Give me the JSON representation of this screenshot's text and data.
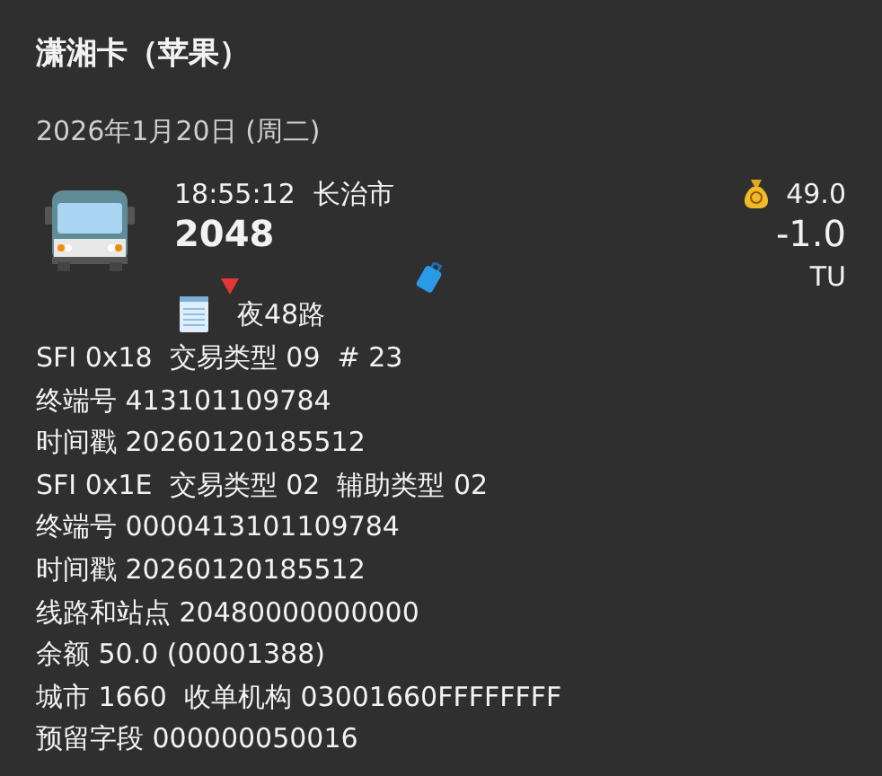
{
  "title": "潇湘卡（苹果）",
  "date": "2026年1月20日 (周二)",
  "trip": {
    "time": "18:55:12",
    "city": "长治市",
    "vehicle": "2048",
    "route": "夜48路",
    "balance": "49.0",
    "amount": "-1.0",
    "currency": "TU"
  },
  "details": [
    "SFI 0x18  交易类型 09  # 23",
    "终端号 413101109784",
    "时间戳 20260120185512",
    "SFI 0x1E  交易类型 02  辅助类型 02",
    "终端号 0000413101109784",
    "时间戳 20260120185512",
    "线路和站点 20480000000000",
    "余额 50.0 (00001388)",
    "城市 1660  收单机构 03001660FFFFFFFF",
    "预留字段 000000050016"
  ]
}
